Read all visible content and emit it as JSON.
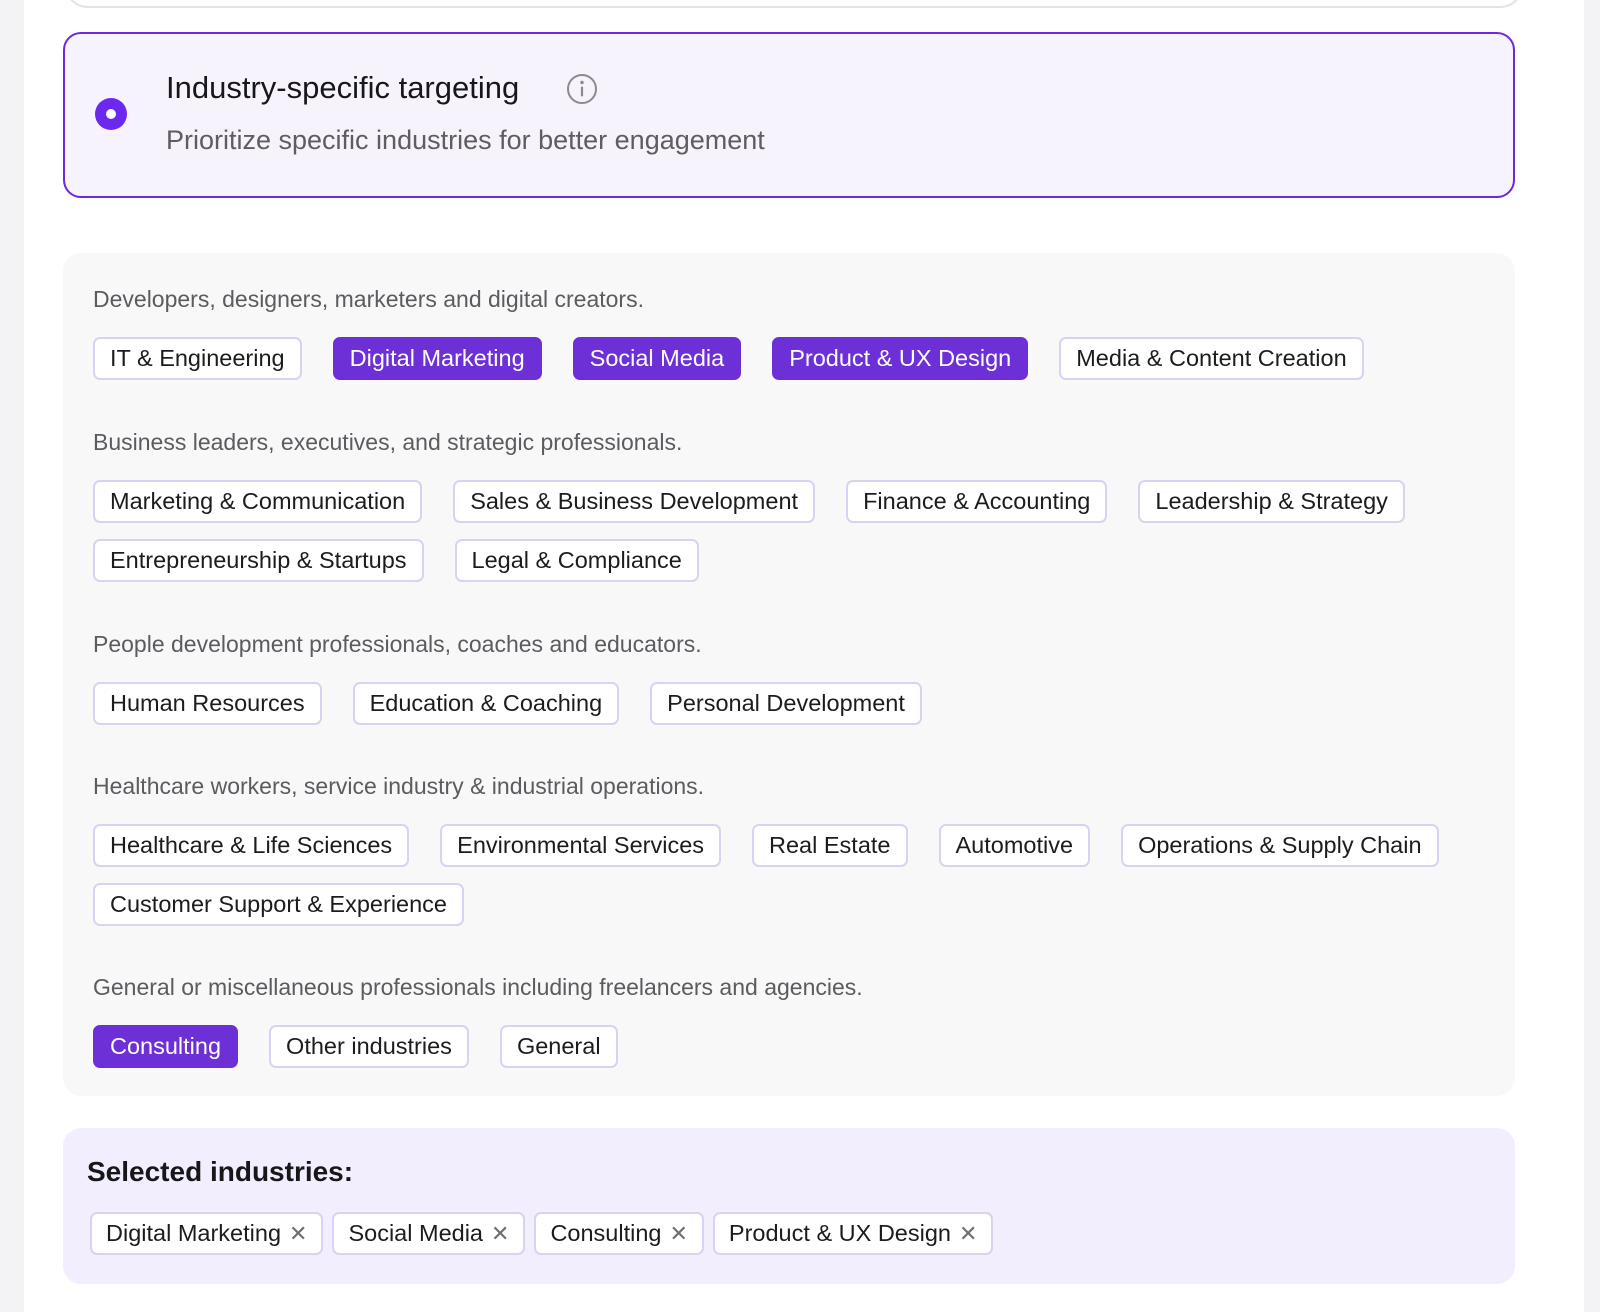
{
  "targeting_option": {
    "title": "Industry-specific targeting",
    "description": "Prioritize specific industries for better engagement",
    "selected": true,
    "accent_color": "#6d28f0"
  },
  "groups": [
    {
      "caption": "Developers, designers, marketers and digital creators.",
      "chips": [
        {
          "label": "IT & Engineering",
          "selected": false
        },
        {
          "label": "Digital Marketing",
          "selected": true
        },
        {
          "label": "Social Media",
          "selected": true
        },
        {
          "label": "Product & UX Design",
          "selected": true
        },
        {
          "label": "Media & Content Creation",
          "selected": false
        }
      ]
    },
    {
      "caption": "Business leaders, executives, and strategic professionals.",
      "chips": [
        {
          "label": "Marketing & Communication",
          "selected": false
        },
        {
          "label": "Sales & Business Development",
          "selected": false
        },
        {
          "label": "Finance & Accounting",
          "selected": false
        },
        {
          "label": "Leadership & Strategy",
          "selected": false
        },
        {
          "label": "Entrepreneurship & Startups",
          "selected": false
        },
        {
          "label": "Legal & Compliance",
          "selected": false
        }
      ]
    },
    {
      "caption": "People development professionals, coaches and educators.",
      "chips": [
        {
          "label": "Human Resources",
          "selected": false
        },
        {
          "label": "Education & Coaching",
          "selected": false
        },
        {
          "label": "Personal Development",
          "selected": false
        }
      ]
    },
    {
      "caption": "Healthcare workers, service industry & industrial operations.",
      "chips": [
        {
          "label": "Healthcare & Life Sciences",
          "selected": false
        },
        {
          "label": "Environmental Services",
          "selected": false
        },
        {
          "label": "Real Estate",
          "selected": false
        },
        {
          "label": "Automotive",
          "selected": false
        },
        {
          "label": "Operations & Supply Chain",
          "selected": false
        },
        {
          "label": "Customer Support & Experience",
          "selected": false
        }
      ]
    },
    {
      "caption": "General or miscellaneous professionals including freelancers and agencies.",
      "chips": [
        {
          "label": "Consulting",
          "selected": true
        },
        {
          "label": "Other industries",
          "selected": false
        },
        {
          "label": "General",
          "selected": false
        }
      ]
    }
  ],
  "selected_industries": {
    "title": "Selected industries:",
    "items": [
      "Digital Marketing",
      "Social Media",
      "Consulting",
      "Product & UX Design"
    ],
    "remove_glyph": "✕"
  }
}
